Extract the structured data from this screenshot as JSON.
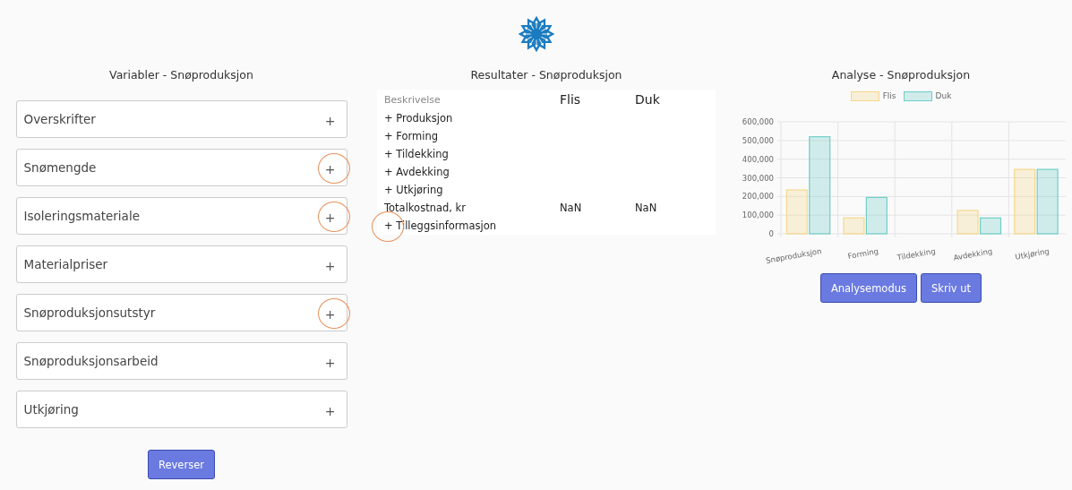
{
  "variables": {
    "title": "Variabler - Snøproduksjon",
    "items": [
      {
        "label": "Overskrifter",
        "toggle": "+",
        "highlighted": false
      },
      {
        "label": "Snømengde",
        "toggle": "+",
        "highlighted": true
      },
      {
        "label": "Isoleringsmateriale",
        "toggle": "+",
        "highlighted": true
      },
      {
        "label": "Materialpriser",
        "toggle": "+",
        "highlighted": false
      },
      {
        "label": "Snøproduksjonsutstyr",
        "toggle": "+",
        "highlighted": true
      },
      {
        "label": "Snøproduksjonsarbeid",
        "toggle": "+",
        "highlighted": false
      },
      {
        "label": "Utkjøring",
        "toggle": "+",
        "highlighted": false
      }
    ],
    "button": "Reverser"
  },
  "results": {
    "title": "Resultater - Snøproduksjon",
    "columns": [
      "Beskrivelse",
      "Flis",
      "Duk"
    ],
    "rows": [
      {
        "kind": "group",
        "label": "+ Produksjon",
        "highlighted": false
      },
      {
        "kind": "group",
        "label": "+ Forming",
        "highlighted": false
      },
      {
        "kind": "group",
        "label": "+ Tildekking",
        "highlighted": false
      },
      {
        "kind": "group",
        "label": "+ Avdekking",
        "highlighted": false
      },
      {
        "kind": "group",
        "label": "+ Utkjøring",
        "highlighted": false
      },
      {
        "kind": "total",
        "label": "Totalkostnad, kr",
        "flis": "NaN",
        "duk": "NaN",
        "highlighted": false
      },
      {
        "kind": "group",
        "label": "+ Tilleggsinformasjon",
        "highlighted": true
      }
    ]
  },
  "analysis": {
    "title": "Analyse - Snøproduksjon",
    "chart_data": {
      "type": "bar",
      "categories": [
        "Snøproduksjon",
        "Forming",
        "Tildekking",
        "Avdekking",
        "Utkjøring"
      ],
      "series": [
        {
          "name": "Flis",
          "color": "#f5d88a",
          "values": [
            235000,
            85000,
            0,
            125000,
            345000
          ]
        },
        {
          "name": "Duk",
          "color": "#6fcdc8",
          "values": [
            520000,
            195000,
            0,
            85000,
            345000
          ]
        }
      ],
      "grid": true,
      "ylim": [
        0,
        600000
      ],
      "yticks": [
        {
          "value": 0,
          "label": "0"
        },
        {
          "value": 100000,
          "label": "100,000"
        },
        {
          "value": 200000,
          "label": "200,000"
        },
        {
          "value": 300000,
          "label": "300,000"
        },
        {
          "value": 400000,
          "label": "400,000"
        },
        {
          "value": 500000,
          "label": "500,000"
        },
        {
          "value": 600000,
          "label": "600,000"
        }
      ]
    },
    "buttons": [
      "Analysemodus",
      "Skriv ut"
    ]
  }
}
